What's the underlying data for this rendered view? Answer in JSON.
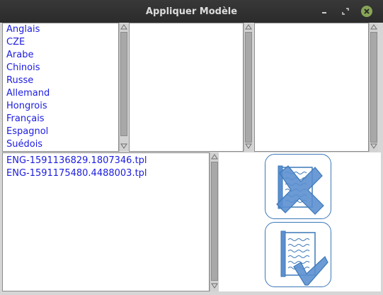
{
  "window": {
    "title": "Appliquer Modèle"
  },
  "languages": [
    "Anglais",
    "CZE",
    "Arabe",
    "Chinois",
    "Russe",
    "Allemand",
    "Hongrois",
    "Français",
    "Espagnol",
    "Suédois"
  ],
  "templates": [
    "ENG-1591136829.1807346.tpl",
    "ENG-1591175480.4488003.tpl"
  ],
  "icons": {
    "minimize": "minimize-icon",
    "maximize": "maximize-icon",
    "close": "close-icon",
    "cancel": "book-cross-icon",
    "apply": "book-check-icon"
  },
  "colors": {
    "item_text": "#1c1ce0",
    "titlebar": "#2f2f2f",
    "close_button": "#87a556",
    "button_border": "#3c78b8",
    "icon_fill": "#5b8fd0"
  }
}
